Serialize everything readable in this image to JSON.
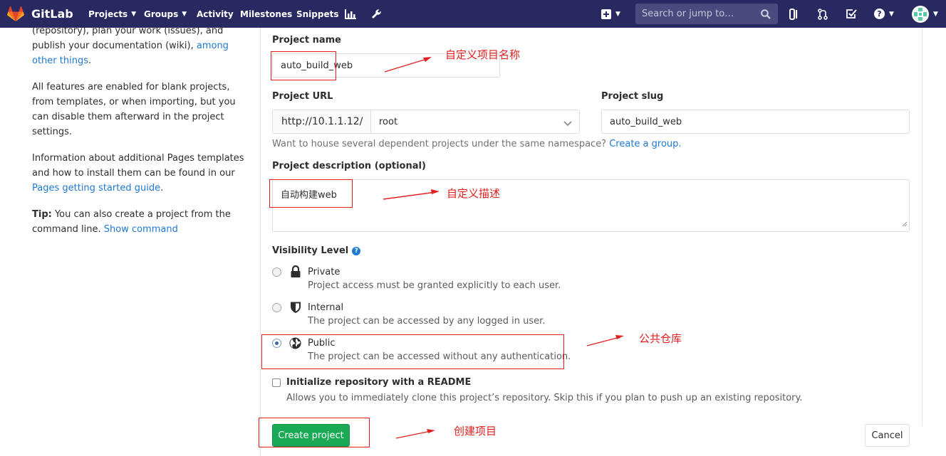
{
  "navbar": {
    "brand": "GitLab",
    "projects": "Projects",
    "groups": "Groups",
    "activity": "Activity",
    "milestones": "Milestones",
    "snippets": "Snippets",
    "search_placeholder": "Search or jump to…",
    "background_color": "#292961"
  },
  "sidebar": {
    "p1_text": "(repository), plan your work (issues), and publish your documentation (wiki), ",
    "p1_link": "among other things",
    "p1_end": ".",
    "p2": "All features are enabled for blank projects, from templates, or when importing, but you can disable them afterward in the project settings.",
    "p3_text": "Information about additional Pages templates and how to install them can be found in our ",
    "p3_link": "Pages getting started guide",
    "p3_end": ".",
    "tip_label": "Tip:",
    "tip_text": " You can also create a project from the command line. ",
    "tip_link": "Show command"
  },
  "form": {
    "project_name_label": "Project name",
    "project_name_value": "auto_build_web",
    "project_url_label": "Project URL",
    "url_prefix": "http://10.1.1.12/",
    "namespace_value": "root",
    "project_slug_label": "Project slug",
    "project_slug_value": "auto_build_web",
    "namespace_help": "Want to house several dependent projects under the same namespace? ",
    "namespace_help_link": "Create a group.",
    "description_label": "Project description (optional)",
    "description_value": "自动构建web",
    "visibility_label": "Visibility Level",
    "visibility": [
      {
        "name": "Private",
        "description": "Project access must be granted explicitly to each user.",
        "checked": false,
        "icon": "lock-icon"
      },
      {
        "name": "Internal",
        "description": "The project can be accessed by any logged in user.",
        "checked": false,
        "icon": "shield-icon"
      },
      {
        "name": "Public",
        "description": "The project can be accessed without any authentication.",
        "checked": true,
        "icon": "globe-icon"
      }
    ],
    "readme_label": "Initialize repository with a README",
    "readme_help": "Allows you to immediately clone this project’s repository. Skip this if you plan to push up an existing repository.",
    "create_button": "Create project",
    "cancel_button": "Cancel"
  },
  "annotations": {
    "project_name": "自定义项目名称",
    "description": "自定义描述",
    "public": "公共仓库",
    "create": "创建项目",
    "color": "#e02020"
  }
}
